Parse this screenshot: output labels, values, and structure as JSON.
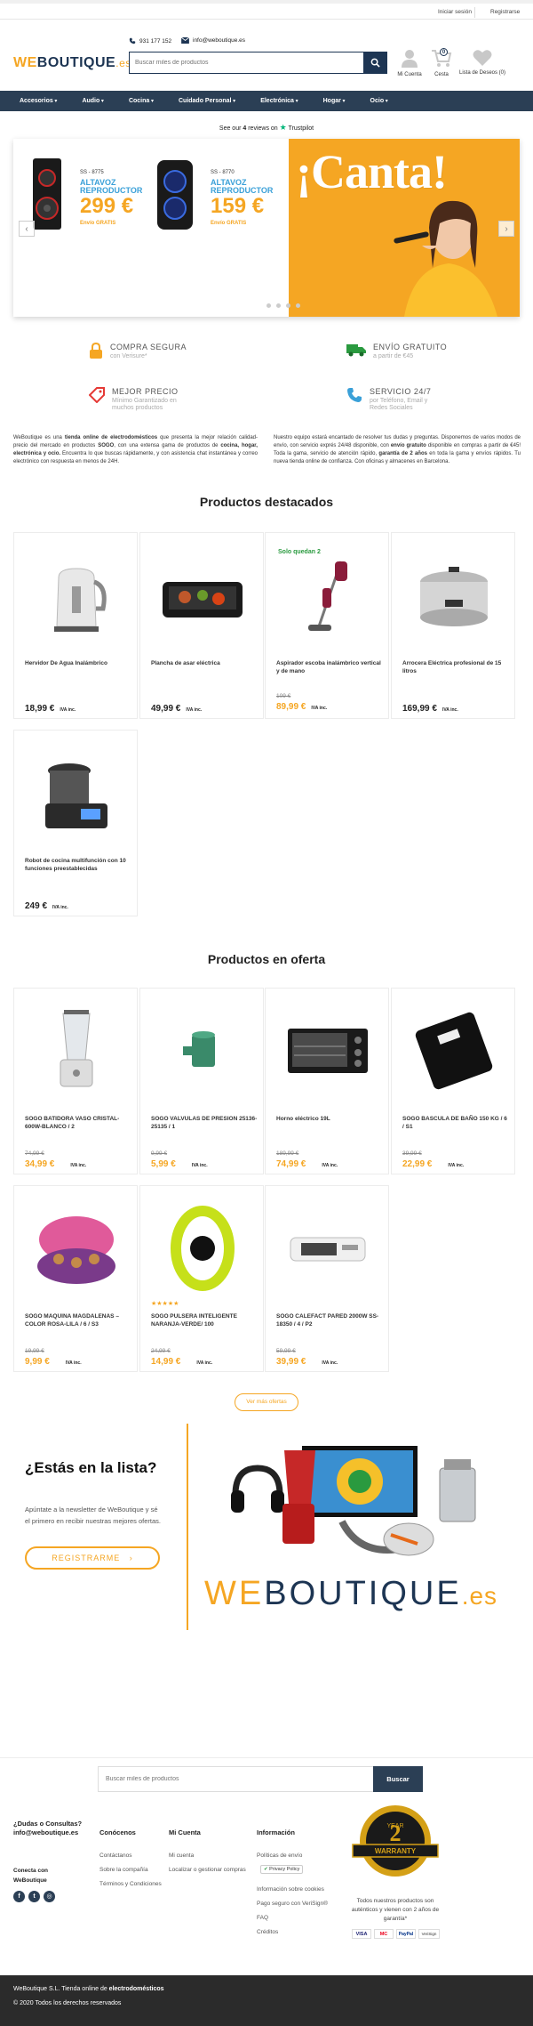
{
  "topbar": {
    "login": "Iniciar sesión",
    "register": "Registrarse"
  },
  "header": {
    "phone": "931 177 152",
    "email": "info@weboutique.es",
    "logo": {
      "we": "WE",
      "boutique": "BOUTIQUE",
      "es": ".es"
    },
    "search_placeholder": "Buscar miles de productos",
    "account_label": "Mi Cuenta",
    "cart_label": "Cesta",
    "cart_count": "0",
    "wishlist_label": "Lista de Deseos (0)"
  },
  "nav": [
    "Accesorios",
    "Audio",
    "Cocina",
    "Cuidado Personal",
    "Electrónica",
    "Hogar",
    "Ocio"
  ],
  "trustpilot": {
    "text_pre": "See our ",
    "count": "4",
    "text_post": " reviews on",
    "brand": "Trustpilot"
  },
  "hero": {
    "p1_model": "SS - 8775",
    "p1_line1": "ALTAVOZ",
    "p1_line2": "REPRODUCTOR",
    "p1_price": "299 €",
    "p1_envio": "Envío GRATIS",
    "p2_model": "SS - 8770",
    "p2_line1": "ALTAVOZ",
    "p2_line2": "REPRODUCTOR",
    "p2_price": "159 €",
    "p2_envio": "Envío GRATIS",
    "headline": "¡Canta!",
    "slides": 4
  },
  "features": [
    {
      "title": "COMPRA SEGURA",
      "sub": "con Verisure*"
    },
    {
      "title": "ENVÍO GRATUITO",
      "sub": "a partir de €45"
    },
    {
      "title": "MEJOR PRECIO",
      "sub": "Mínimo Garantizado en muchos productos"
    },
    {
      "title": "SERVICIO 24/7",
      "sub": "por Teléfono, Email y Redes Sociales"
    }
  ],
  "intro": {
    "left_1": "WeBoutique es una ",
    "left_b1": "tienda online de electrodomésticos",
    "left_2": " que presenta la mejor relación calidad-precio del mercado en productos ",
    "left_b2": "SOGO",
    "left_3": ", con una extensa gama de productos de ",
    "left_b3": "cocina, hogar, electrónica y ocio.",
    "left_4": " Encuentra lo que buscas rápidamente, y con asistencia chat instantánea y correo electrónico con respuesta en menos de 24H.",
    "right_1": "Nuestro equipo estará encantado de resolver tus dudas y preguntas. Disponemos de varios modos de envío, con servicio exprés 24/48 disponible, con ",
    "right_b1": "envío gratuito",
    "right_2": " disponible en compras a partir de €45! Toda la gama, servicio de atención rápido, ",
    "right_b2": "garantía de 2 años",
    "right_3": " en toda la gama y envíos rápidos. Tu nueva tienda online de confianza. Con oficinas y almacenes en Barcelona."
  },
  "featured_title": "Productos destacados",
  "featured": [
    {
      "name": "Hervidor De Agua Inalámbrico",
      "price": "18,99 €",
      "iva": "IVA inc.",
      "icon": "kettle-icon"
    },
    {
      "name": "Plancha de asar eléctrica",
      "price": "49,99 €",
      "iva": "IVA inc.",
      "icon": "grill-icon"
    },
    {
      "name": "Aspirador escoba inalámbrico vertical y de mano",
      "old": "109 €",
      "price": "89,99 €",
      "iva": "IVA inc.",
      "tag": "Solo quedan 2",
      "icon": "vacuum-icon"
    },
    {
      "name": "Arrocera Eléctrica profesional de 15 litros",
      "price": "169,99 €",
      "iva": "IVA inc.",
      "icon": "rice-cooker-icon"
    },
    {
      "name": "Robot de cocina multifunción con 10 funciones preestablecidas",
      "price": "249 €",
      "iva": "IVA inc.",
      "icon": "food-processor-icon"
    }
  ],
  "offers_title": "Productos en oferta",
  "offers": [
    {
      "name": "SOGO BATIDORA VASO CRISTAL-600W-BLANCO / 2",
      "old": "74,99 €",
      "price": "34,99 €",
      "iva": "IVA inc.",
      "icon": "blender-icon"
    },
    {
      "name": "SOGO VALVULAS DE PRESION 25136-25135 / 1",
      "old": "9,99 €",
      "price": "5,99 €",
      "iva": "IVA inc.",
      "icon": "valve-icon"
    },
    {
      "name": "Horno eléctrico 19L",
      "old": "189,99 €",
      "price": "74,99 €",
      "iva": "IVA inc.",
      "icon": "oven-icon"
    },
    {
      "name": "SOGO BASCULA DE BAÑO 150 KG / 6 / S1",
      "old": "39,99 €",
      "price": "22,99 €",
      "iva": "IVA inc.",
      "icon": "scale-icon"
    },
    {
      "name": "SOGO MAQUINA MAGDALENAS – COLOR ROSA-LILA / 6 / S3",
      "old": "19,99 €",
      "price": "9,99 €",
      "iva": "IVA inc.",
      "icon": "cupcake-maker-icon"
    },
    {
      "name": "SOGO PULSERA INTELIGENTE NARANJA-VERDE/ 100",
      "old": "24,99 €",
      "price": "14,99 €",
      "iva": "IVA inc.",
      "rating": 5,
      "icon": "smartband-icon"
    },
    {
      "name": "SOGO CALEFACT PARED 2000W SS-18350 / 4 / P2",
      "old": "59,99 €",
      "price": "39,99 €",
      "iva": "IVA inc.",
      "icon": "heater-icon"
    }
  ],
  "see_more": "Ver más ofertas",
  "newsletter": {
    "title": "¿Estás en la lista?",
    "text": "Apúntate a la newsletter de WeBoutique y sé el primero en recibir nuestras mejores ofertas.",
    "button": "REGISTRARME",
    "brand_we": "WE",
    "brand_bq": "BOUTIQUE",
    "brand_es": ".es"
  },
  "footer": {
    "search_placeholder": "Buscar miles de productos",
    "search_button": "Buscar",
    "help_title": "¿Dudas o Consultas?",
    "help_email": "info@weboutique.es",
    "connect": "Conecta con WeBoutique",
    "col1_title": "Conócenos",
    "col1": [
      "Contáctanos",
      "Sobre la compañía",
      "Términos y Condiciones"
    ],
    "col2_title": "Mi Cuenta",
    "col2": [
      "Mi cuenta",
      "Localizar o gestionar compras"
    ],
    "col3_title": "Información",
    "col3": [
      "Políticas de envío",
      "Privacy Policy",
      "Información sobre cookies",
      "Pago seguro con VeriSign®",
      "FAQ",
      "Créditos"
    ],
    "warranty_year": "2",
    "warranty_word": "YEAR",
    "warranty_band": "WARRANTY",
    "guarantee": "Todos nuestros productos son auténticos y vienen con 2 años de garantía*",
    "payments": [
      "VISA",
      "MC",
      "PayPal",
      "VeriSign"
    ],
    "company_pre": "WeBoutique S.L. Tienda online de ",
    "company_bold": "electrodomésticos",
    "copyright": "© 2020 Todos los derechos reservados"
  }
}
